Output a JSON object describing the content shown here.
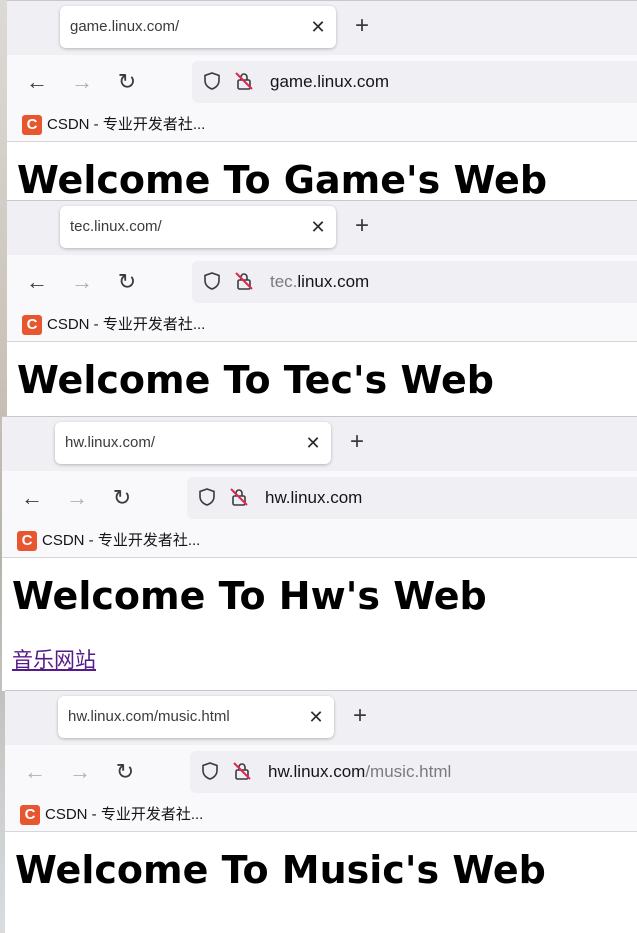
{
  "windows": [
    {
      "tab_title": "game.linux.com/",
      "new_tab_symbol": "+",
      "close_symbol": "✕",
      "url_main": "game.linux.com",
      "url_dim_prefix": "",
      "url_dim_suffix": "",
      "back_enabled": true,
      "forward_enabled": false,
      "bookmark_label": "CSDN - 专业开发者社...",
      "heading": "Welcome To Game's Web",
      "link": ""
    },
    {
      "tab_title": "tec.linux.com/",
      "new_tab_symbol": "+",
      "close_symbol": "✕",
      "url_main": "linux.com",
      "url_dim_prefix": "tec.",
      "url_dim_suffix": "",
      "back_enabled": true,
      "forward_enabled": false,
      "bookmark_label": "CSDN - 专业开发者社...",
      "heading": "Welcome To Tec's Web",
      "link": ""
    },
    {
      "tab_title": "hw.linux.com/",
      "new_tab_symbol": "+",
      "close_symbol": "✕",
      "url_main": "hw.linux.com",
      "url_dim_prefix": "",
      "url_dim_suffix": "",
      "back_enabled": true,
      "forward_enabled": false,
      "bookmark_label": "CSDN - 专业开发者社...",
      "heading": "Welcome To Hw's Web",
      "link": "音乐网站"
    },
    {
      "tab_title": "hw.linux.com/music.html",
      "new_tab_symbol": "+",
      "close_symbol": "✕",
      "url_main": "hw.linux.com",
      "url_dim_prefix": "",
      "url_dim_suffix": "/music.html",
      "back_enabled": false,
      "forward_enabled": false,
      "bookmark_label": "CSDN - 专业开发者社...",
      "heading": "Welcome To Music's Web",
      "link": ""
    }
  ],
  "icons": {
    "back": "arrow-left-icon",
    "forward": "arrow-right-icon",
    "reload": "reload-icon",
    "shield": "shield-icon",
    "lock": "insecure-lock-icon",
    "bookmark": "csdn-favicon-icon"
  },
  "bookmark_favicon_letter": "C",
  "colors": {
    "tabstrip": "#f0f0f4",
    "toolbar": "#f9f9fb",
    "urlbar": "#f0f0f4",
    "visited_link": "#551a8b",
    "csdn_brand": "#e8562f",
    "insecure_slash": "#e22850"
  }
}
